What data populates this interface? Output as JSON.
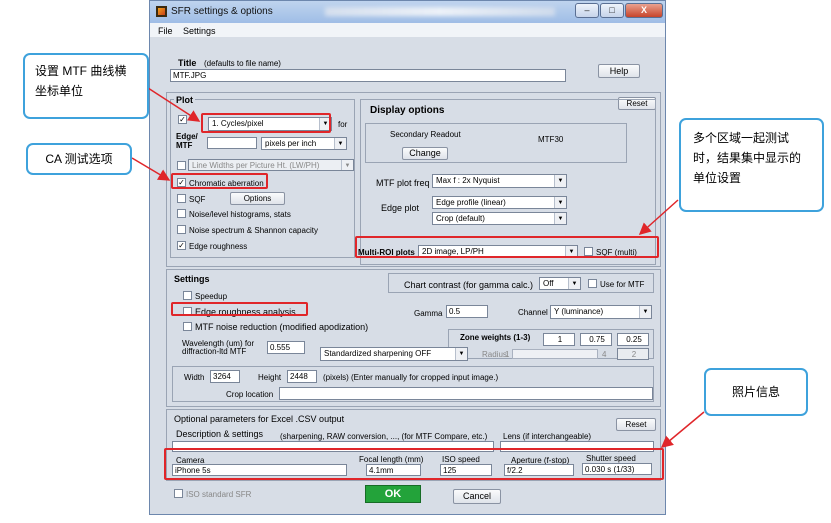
{
  "window": {
    "title": "SFR settings & options",
    "min_label": "–",
    "max_label": "□",
    "close_label": "X"
  },
  "menu": [
    "File",
    "Settings"
  ],
  "title_field": {
    "label": "Title",
    "hint": "(defaults to file name)",
    "value": "MTF.JPG"
  },
  "help_label": "Help",
  "plot": {
    "heading": "Plot",
    "reset_label": "Reset",
    "units_value": "1. Cycles/pixel",
    "for_label": "for",
    "edge_mtf_label_1": "Edge/",
    "edge_mtf_label_2": "MTF",
    "pixels_per_unit": "pixels per inch",
    "line_widths": "Line Widths per Picture Ht. (LW/PH)",
    "chromatic_aberration": "Chromatic aberration",
    "sqf": "SQF",
    "options_label": "Options",
    "noise_hist": "Noise/level histograms, stats",
    "noise_spectrum": "Noise spectrum & Shannon capacity",
    "edge_roughness": "Edge roughness",
    "check_mark": "✓"
  },
  "display": {
    "heading": "Display options",
    "secondary_readout": "Secondary Readout",
    "mtf30": "MTF30",
    "change_label": "Change",
    "mtf_plot_freq_label": "MTF plot freq",
    "mtf_plot_freq_value": "Max f :   2x Nyquist",
    "edge_plot_label": "Edge plot",
    "edge_plot_value_1": "Edge profile (linear)",
    "edge_plot_value_2": "Crop (default)",
    "multi_roi_label": "Multi-ROI plots",
    "multi_roi_value": "2D image, LP/PH",
    "sqf_multi": "SQF (multi)"
  },
  "settings": {
    "heading": "Settings",
    "chart_contrast_label": "Chart contrast (for gamma calc.)",
    "chart_contrast_value": "Off",
    "use_for_mtf": "Use for MTF",
    "speedup": "Speedup",
    "edge_roughness_analysis": "Edge roughness analysis",
    "gamma_label": "Gamma",
    "gamma_value": "0.5",
    "channel_label": "Channel",
    "channel_value": "Y (luminance)",
    "mtf_noise_reduction": "MTF noise reduction (modified apodization)",
    "zone_weights_label": "Zone weights (1-3)",
    "zone_weights": [
      "1",
      "0.75",
      "0.25"
    ],
    "wavelength_label_1": "Wavelength (um) for",
    "wavelength_label_2": "diffraction-ltd MTF",
    "wavelength_value": "0.555",
    "sharpening_value": "Standardized sharpening OFF",
    "radius_label": "Radius",
    "radius_value_1": "4",
    "radius_value_2": "1",
    "radius_value_3": "2",
    "width_label": "Width",
    "width_value": "3264",
    "height_label": "Height",
    "height_value": "2448",
    "pixels_note": "(pixels)  (Enter manually for cropped input image.)",
    "crop_location": "Crop location"
  },
  "optional": {
    "heading": "Optional parameters  for Excel .CSV output",
    "reset_label": "Reset",
    "description_label": "Description & settings",
    "description_hint": "(sharpening, RAW conversion, ..., (for MTF Compare, etc.)",
    "lens_label": "Lens (if interchangeable)",
    "camera_label": "Camera",
    "camera_value": "iPhone 5s",
    "focal_label": "Focal length (mm)",
    "focal_value": "4.1mm",
    "iso_label": "ISO speed",
    "iso_value": "125",
    "aperture_label": "Aperture (f-stop)",
    "aperture_value": "f/2.2",
    "shutter_label": "Shutter speed",
    "shutter_value": "0.030 s  (1/33)"
  },
  "iso_standard_sfr": "ISO standard SFR",
  "ok_label": "OK",
  "cancel_label": "Cancel",
  "callouts": {
    "units": "设置 MTF 曲线横坐标单位",
    "ca": "CA 测试选项",
    "multi": "多个区域一起测试时，结果集中显示的单位设置",
    "photo": "照片信息"
  },
  "colors": {
    "callout_border": "#3ea2dc",
    "highlight": "#e0262a",
    "ok_green": "#23a33a"
  }
}
